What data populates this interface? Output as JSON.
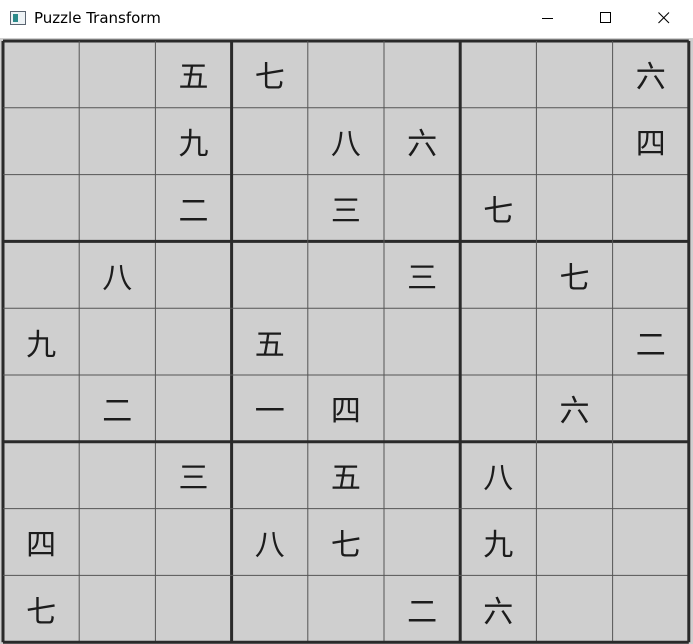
{
  "window": {
    "title": "Puzzle Transform",
    "icons": {
      "app": "app-icon",
      "minimize": "minimize-icon",
      "maximize": "maximize-icon",
      "close": "close-icon"
    }
  },
  "puzzle": {
    "rows": [
      [
        "",
        "",
        "五",
        "七",
        "",
        "",
        "",
        "",
        "六"
      ],
      [
        "",
        "",
        "九",
        "",
        "八",
        "六",
        "",
        "",
        "四"
      ],
      [
        "",
        "",
        "二",
        "",
        "三",
        "",
        "七",
        "",
        ""
      ],
      [
        "",
        "八",
        "",
        "",
        "",
        "三",
        "",
        "七",
        ""
      ],
      [
        "九",
        "",
        "",
        "五",
        "",
        "",
        "",
        "",
        "二"
      ],
      [
        "",
        "二",
        "",
        "一",
        "四",
        "",
        "",
        "六",
        ""
      ],
      [
        "",
        "",
        "三",
        "",
        "五",
        "",
        "八",
        "",
        ""
      ],
      [
        "四",
        "",
        "",
        "八",
        "七",
        "",
        "九",
        "",
        ""
      ],
      [
        "七",
        "",
        "",
        "",
        "",
        "二",
        "六",
        "",
        ""
      ]
    ]
  }
}
